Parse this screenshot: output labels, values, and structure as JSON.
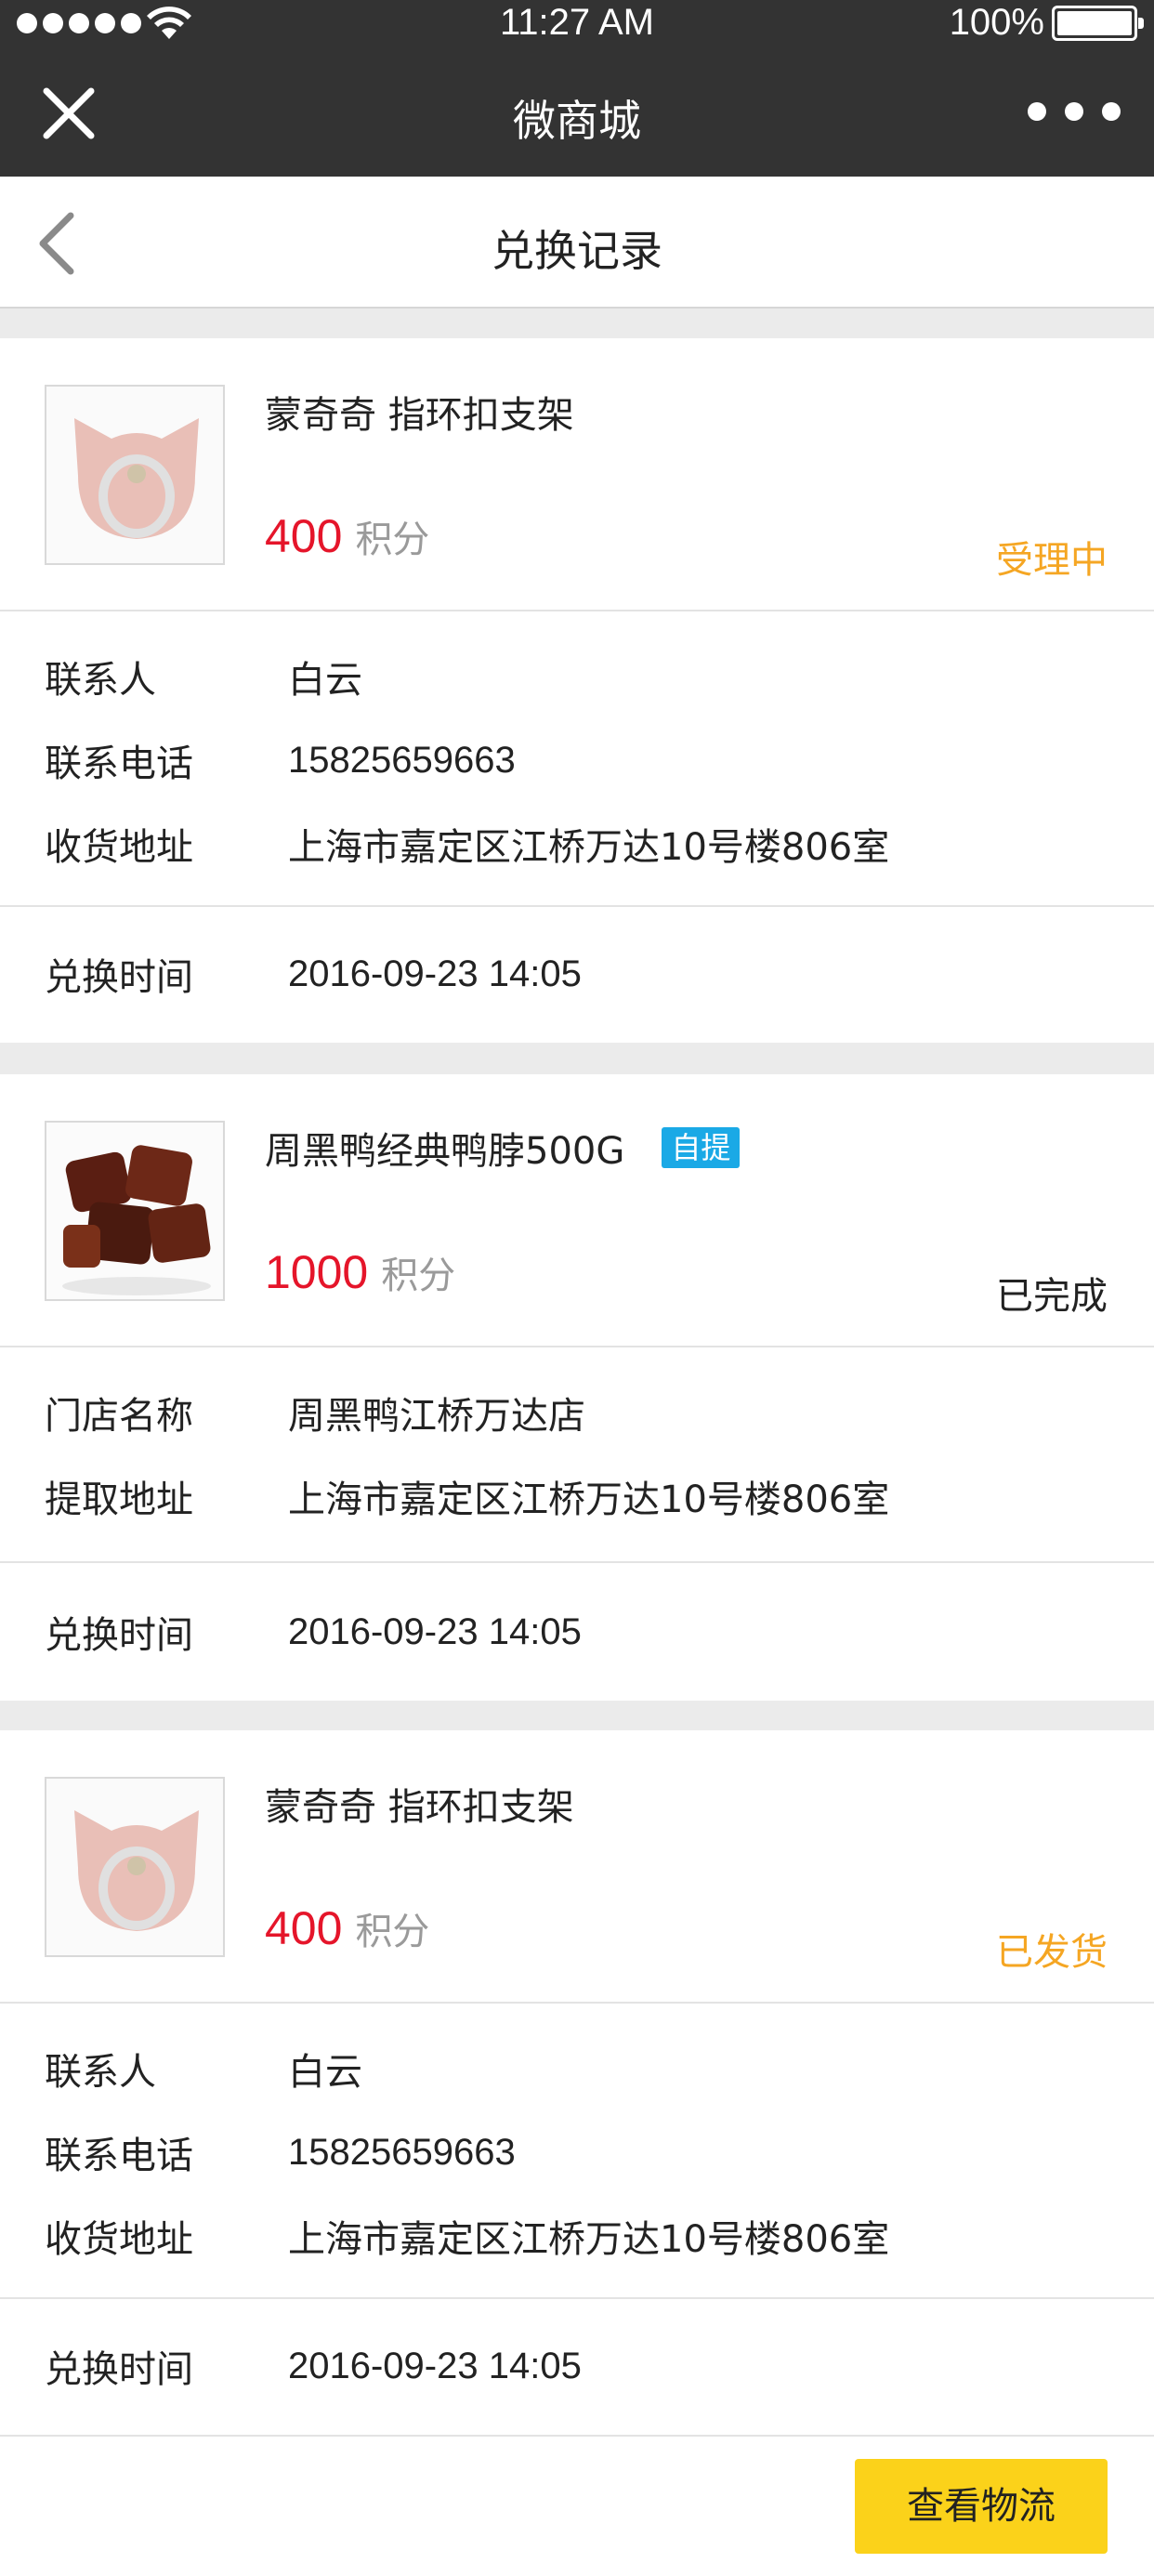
{
  "status_bar": {
    "time": "11:27 AM",
    "battery": "100%",
    "icons": [
      "signal-dots-icon",
      "wifi-icon",
      "battery-icon"
    ]
  },
  "wechat_bar": {
    "title": "微商城",
    "close_icon": "close-icon",
    "more_icon": "more-dots-icon"
  },
  "header": {
    "title": "兑换记录",
    "back_icon": "chevron-left-icon"
  },
  "orders": [
    {
      "product_name": "蒙奇奇 指环扣支架",
      "price": "400",
      "price_unit": "积分",
      "status": "受理中",
      "status_color": "#f5a623",
      "contact_label": "联系人",
      "contact": "白云",
      "phone_label": "联系电话",
      "phone": "15825659663",
      "address_label": "收货地址",
      "address": "上海市嘉定区江桥万达10号楼806室",
      "time_label": "兑换时间",
      "time": "2016-09-23  14:05"
    },
    {
      "product_name": "周黑鸭经典鸭脖500G",
      "tag": "自提",
      "tag_color": "#1aa9e6",
      "price": "1000",
      "price_unit": "积分",
      "status": "已完成",
      "status_color": "#222222",
      "store_label": "门店名称",
      "store": "周黑鸭江桥万达店",
      "pickup_label": "提取地址",
      "pickup": "上海市嘉定区江桥万达10号楼806室",
      "time_label": "兑换时间",
      "time": "2016-09-23  14:05"
    },
    {
      "product_name": "蒙奇奇 指环扣支架",
      "price": "400",
      "price_unit": "积分",
      "status": "已发货",
      "status_color": "#f5a623",
      "contact_label": "联系人",
      "contact": "白云",
      "phone_label": "联系电话",
      "phone": "15825659663",
      "address_label": "收货地址",
      "address": "上海市嘉定区江桥万达10号楼806室",
      "time_label": "兑换时间",
      "time": "2016-09-23  14:05",
      "action_label": "查看物流"
    }
  ],
  "colors": {
    "price": "#e5152a",
    "accent_button": "#fbd21a",
    "topbar": "#333333"
  }
}
